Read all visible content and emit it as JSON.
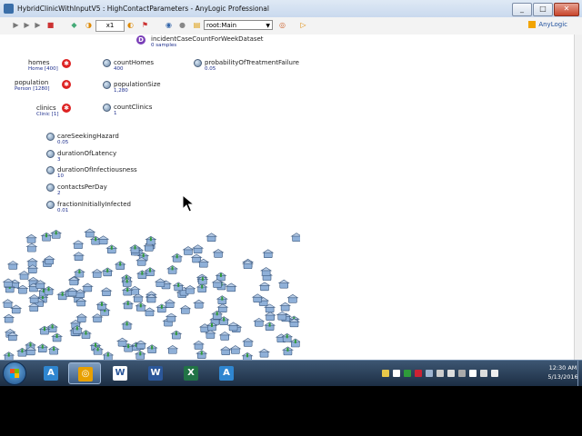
{
  "window": {
    "title": "HybridClinicWithInputV5 : HighContactParameters - AnyLogic Professional",
    "controls": [
      "_",
      "□",
      "✕"
    ]
  },
  "toolbar": {
    "speed": "x1",
    "root_selector": "root:Main",
    "brand": "AnyLogic"
  },
  "model": {
    "dataset": {
      "name": "incidentCaseCountForWeekDataset",
      "value": "0 samples"
    },
    "agents": [
      {
        "name": "homes",
        "value": "Home [400]"
      },
      {
        "name": "population",
        "value": "Person [1280]"
      },
      {
        "name": "clinics",
        "value": "Clinic [1]"
      }
    ],
    "computed_params": [
      {
        "name": "countHomes",
        "value": "400"
      },
      {
        "name": "populationSize",
        "value": "1,280"
      },
      {
        "name": "countClinics",
        "value": "1"
      }
    ],
    "probability": {
      "name": "probabilityOfTreatmentFailure",
      "value": "0.05"
    },
    "parameters": [
      {
        "name": "careSeekingHazard",
        "value": "0.05"
      },
      {
        "name": "durationOfLatency",
        "value": "3"
      },
      {
        "name": "durationOfInfectiousness",
        "value": "10"
      },
      {
        "name": "contactsPerDay",
        "value": "2"
      },
      {
        "name": "fractionInitiallyInfected",
        "value": "0.01"
      }
    ]
  },
  "taskbar": {
    "apps": [
      {
        "name": "anylogic",
        "color": "#2f86d0"
      },
      {
        "name": "browser",
        "color": "#e8a000"
      },
      {
        "name": "word-doc",
        "color": "#ffffff"
      },
      {
        "name": "word",
        "color": "#2b579a"
      },
      {
        "name": "excel",
        "color": "#217346"
      },
      {
        "name": "anylogic-2",
        "color": "#2f86d0"
      }
    ],
    "clock": {
      "time": "12:30 AM",
      "date": "5/13/2016"
    }
  },
  "colors": {
    "value_text": "#1e2f8e",
    "agent_icon": "#dd2222",
    "house": "#8fb0d8",
    "person": "#2f9a3a"
  }
}
